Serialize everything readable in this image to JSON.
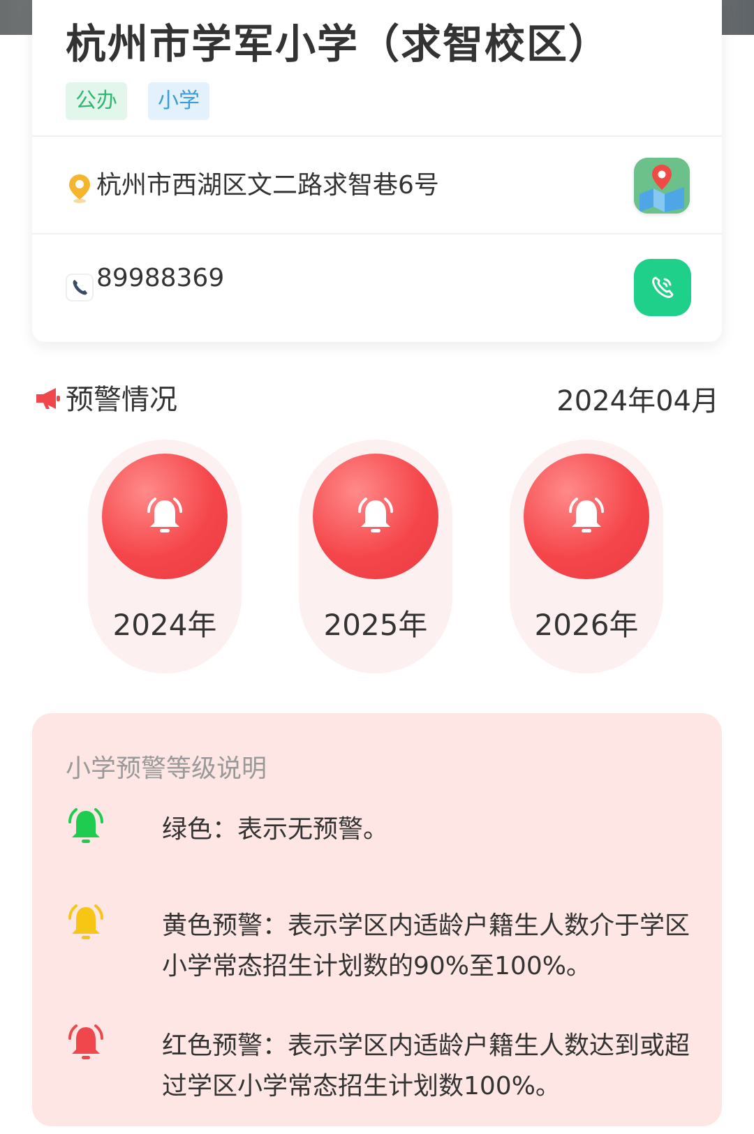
{
  "school": {
    "name": "杭州市学军小学（求智校区）",
    "tags": [
      "公办",
      "小学"
    ],
    "address": "杭州市西湖区文二路求智巷6号",
    "phone": "89988369"
  },
  "warning": {
    "title": "预警情况",
    "date": "2024年04月",
    "years": [
      {
        "label": "2024年",
        "level": "red"
      },
      {
        "label": "2025年",
        "level": "red"
      },
      {
        "label": "2026年",
        "level": "red"
      }
    ]
  },
  "legend": {
    "title": "小学预警等级说明",
    "items": [
      {
        "color": "#1fcc4f",
        "text": "绿色：表示无预警。"
      },
      {
        "color": "#f7c514",
        "text": "黄色预警：表示学区内适龄户籍生人数介于学区小学常态招生计划数的90%至100%。"
      },
      {
        "color": "#f0474c",
        "text": "红色预警：表示学区内适龄户籍生人数达到或超过学区小学常态招生计划数100%。"
      }
    ]
  },
  "colors": {
    "accent_green": "#1fd08a",
    "alert_red": "#f5474b"
  }
}
